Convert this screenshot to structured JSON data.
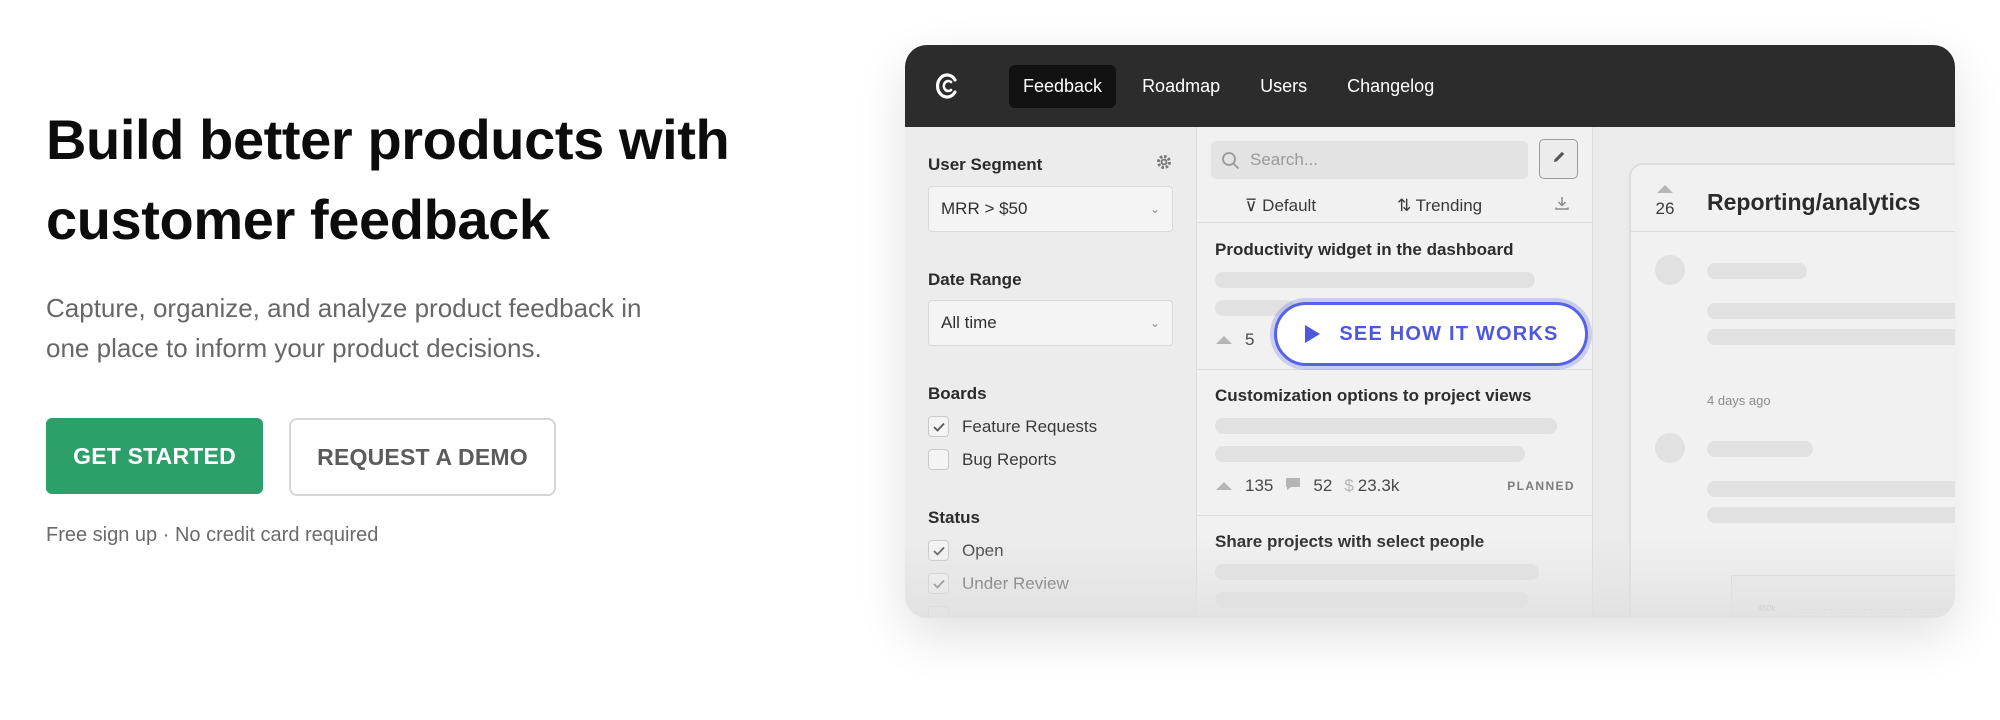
{
  "hero": {
    "title_line1": "Build better products with",
    "title_line2": "customer feedback",
    "subtitle_line1": "Capture, organize, and analyze product feedback in",
    "subtitle_line2": "one place to inform your product decisions.",
    "primary_cta": "GET STARTED",
    "secondary_cta": "REQUEST A DEMO",
    "fine_print": "Free sign up · No credit card required"
  },
  "colors": {
    "primary": "#2da06a",
    "accent": "#5662e9",
    "appbar": "#2c2c2c"
  },
  "app": {
    "nav": [
      "Feedback",
      "Roadmap",
      "Users",
      "Changelog"
    ],
    "active_tab": "Feedback",
    "filters": {
      "user_segment_label": "User Segment",
      "user_segment_value": "MRR > $50",
      "date_range_label": "Date Range",
      "date_range_value": "All time",
      "boards_label": "Boards",
      "boards": [
        {
          "label": "Feature Requests",
          "checked": true
        },
        {
          "label": "Bug Reports",
          "checked": false
        }
      ],
      "status_label": "Status",
      "statuses": [
        {
          "label": "Open",
          "checked": true
        },
        {
          "label": "Under Review",
          "checked": true
        }
      ]
    },
    "list": {
      "search_placeholder": "Search...",
      "sort_default": "Default",
      "sort_trending": "Trending",
      "posts": [
        {
          "title": "Productivity widget in the dashboard",
          "votes": "5"
        },
        {
          "title": "Customization options to project views",
          "votes": "135",
          "comments": "52",
          "mrr": "23.3k",
          "status": "PLANNED"
        },
        {
          "title": "Share projects with select people"
        }
      ]
    },
    "video_cta": "SEE HOW IT WORKS",
    "detail": {
      "votes": "26",
      "title": "Reporting/analytics",
      "timestamp": "4 days ago",
      "chart_tick": "450k"
    }
  }
}
